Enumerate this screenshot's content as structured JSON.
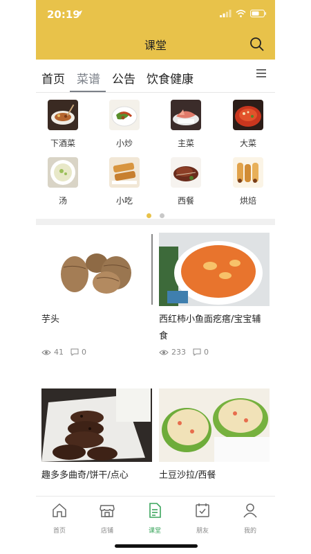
{
  "status_bar": {
    "time": "20:19"
  },
  "header": {
    "title": "课堂"
  },
  "tabs": [
    {
      "label": "首页",
      "active": false
    },
    {
      "label": "菜谱",
      "active": true
    },
    {
      "label": "公告",
      "active": false
    },
    {
      "label": "饮食健康",
      "active": false
    }
  ],
  "categories": [
    {
      "label": "下酒菜"
    },
    {
      "label": "小炒"
    },
    {
      "label": "主菜"
    },
    {
      "label": "大菜"
    },
    {
      "label": "汤"
    },
    {
      "label": "小吃"
    },
    {
      "label": "西餐"
    },
    {
      "label": "烘焙"
    }
  ],
  "recipes": [
    {
      "title": "芋头",
      "views": "41",
      "comments": "0"
    },
    {
      "title": "西红柿小鱼面疙瘩/宝宝辅食",
      "views": "233",
      "comments": "0"
    },
    {
      "title": "趣多多曲奇/饼干/点心"
    },
    {
      "title": "土豆沙拉/西餐"
    }
  ],
  "bottom_nav": [
    {
      "label": "首页",
      "icon": "home-icon"
    },
    {
      "label": "店铺",
      "icon": "store-icon"
    },
    {
      "label": "课堂",
      "icon": "classroom-icon",
      "active": true
    },
    {
      "label": "朋友",
      "icon": "calendar-check-icon"
    },
    {
      "label": "我的",
      "icon": "user-icon"
    }
  ],
  "colors": {
    "header": "#e8c24a",
    "active_nav": "#3aa55c",
    "tab_active": "#7b8088"
  }
}
